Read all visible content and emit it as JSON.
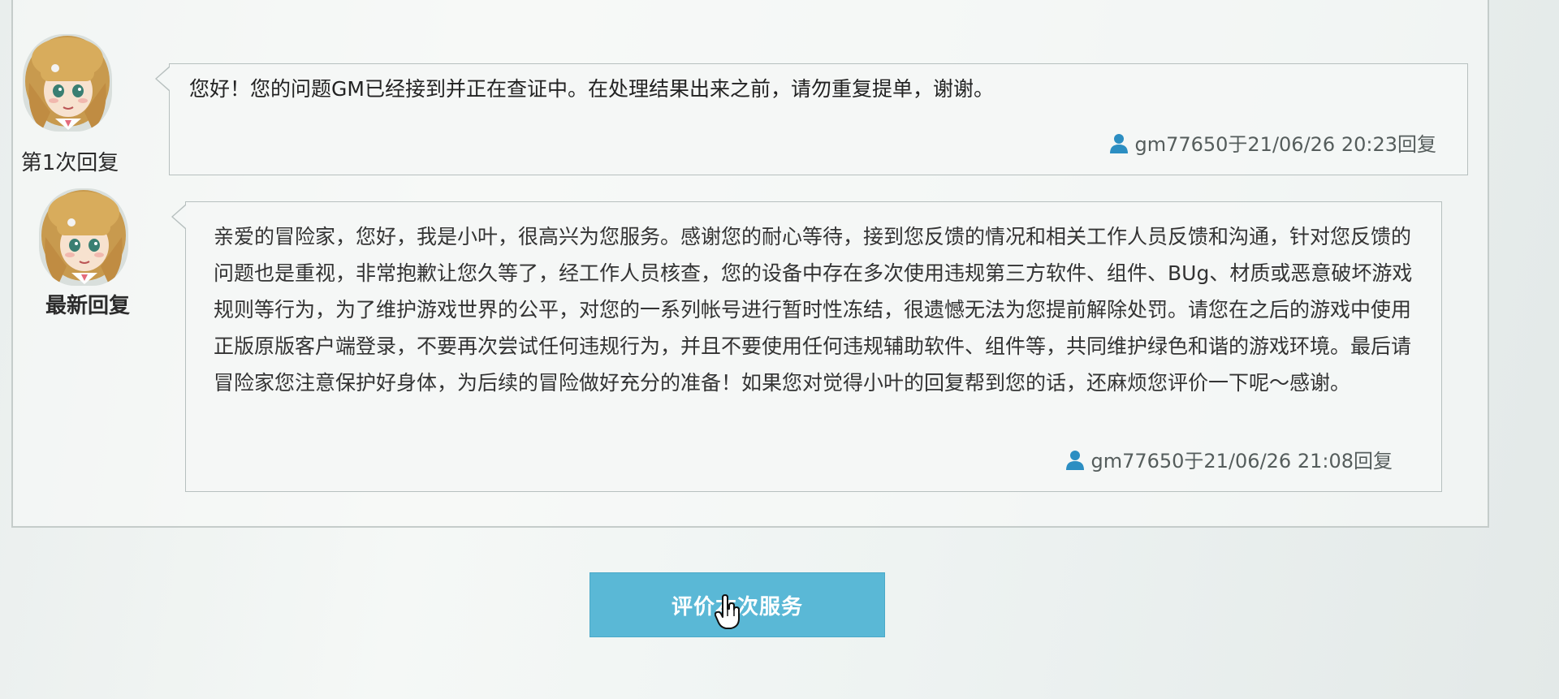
{
  "replies": [
    {
      "caption": "第1次回复",
      "message": "您好！您的问题GM已经接到并正在查证中。在处理结果出来之前，请勿重复提单，谢谢。",
      "meta": "gm77650于21/06/26 20:23回复"
    },
    {
      "caption": "最新回复",
      "message": "亲爱的冒险家，您好，我是小叶，很高兴为您服务。感谢您的耐心等待，接到您反馈的情况和相关工作人员反馈和沟通，针对您反馈的问题也是重视，非常抱歉让您久等了，经工作人员核查，您的设备中存在多次使用违规第三方软件、组件、BUg、材质或恶意破坏游戏规则等行为，为了维护游戏世界的公平，对您的一系列帐号进行暂时性冻结，很遗憾无法为您提前解除处罚。请您在之后的游戏中使用正版原版客户端登录，不要再次尝试任何违规行为，并且不要使用任何违规辅助软件、组件等，共同维护绿色和谐的游戏环境。最后请冒险家您注意保护好身体，为后续的冒险做好充分的准备！如果您对觉得小叶的回复帮到您的话，还麻烦您评价一下呢～感谢。",
      "meta": "gm77650于21/06/26 21:08回复"
    }
  ],
  "button": {
    "label": "评价本次服务"
  },
  "colors": {
    "button": "#5ab8d6",
    "user_icon": "#2c8ec2"
  },
  "icons": {
    "user": "user-icon",
    "cursor": "hand-pointer-icon"
  }
}
